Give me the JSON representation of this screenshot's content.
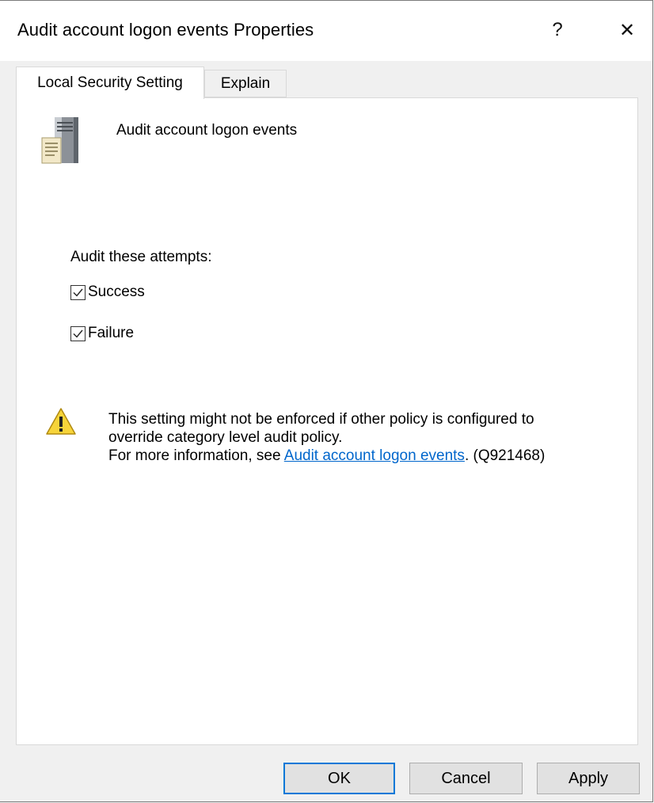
{
  "window": {
    "title": "Audit account logon events Properties",
    "help_glyph": "?",
    "close_glyph": "✕"
  },
  "tabs": [
    {
      "label": "Local Security Setting",
      "active": true
    },
    {
      "label": "Explain",
      "active": false
    }
  ],
  "policy": {
    "name": "Audit account logon events",
    "icon": "server-policy-icon"
  },
  "audit": {
    "label": "Audit these attempts:",
    "options": [
      {
        "label": "Success",
        "checked": true
      },
      {
        "label": "Failure",
        "checked": true
      }
    ]
  },
  "warning": {
    "icon": "warning-icon",
    "line1": "This setting might not be enforced if other policy is configured to",
    "line2": "override category level audit policy.",
    "line3_prefix": "For more information, see ",
    "link_text": "Audit account logon events",
    "line3_suffix": ". (Q921468)"
  },
  "buttons": {
    "ok": "OK",
    "cancel": "Cancel",
    "apply": "Apply"
  },
  "colors": {
    "accent": "#0078d7",
    "link": "#0066cc",
    "warning": "#f7d43a"
  }
}
